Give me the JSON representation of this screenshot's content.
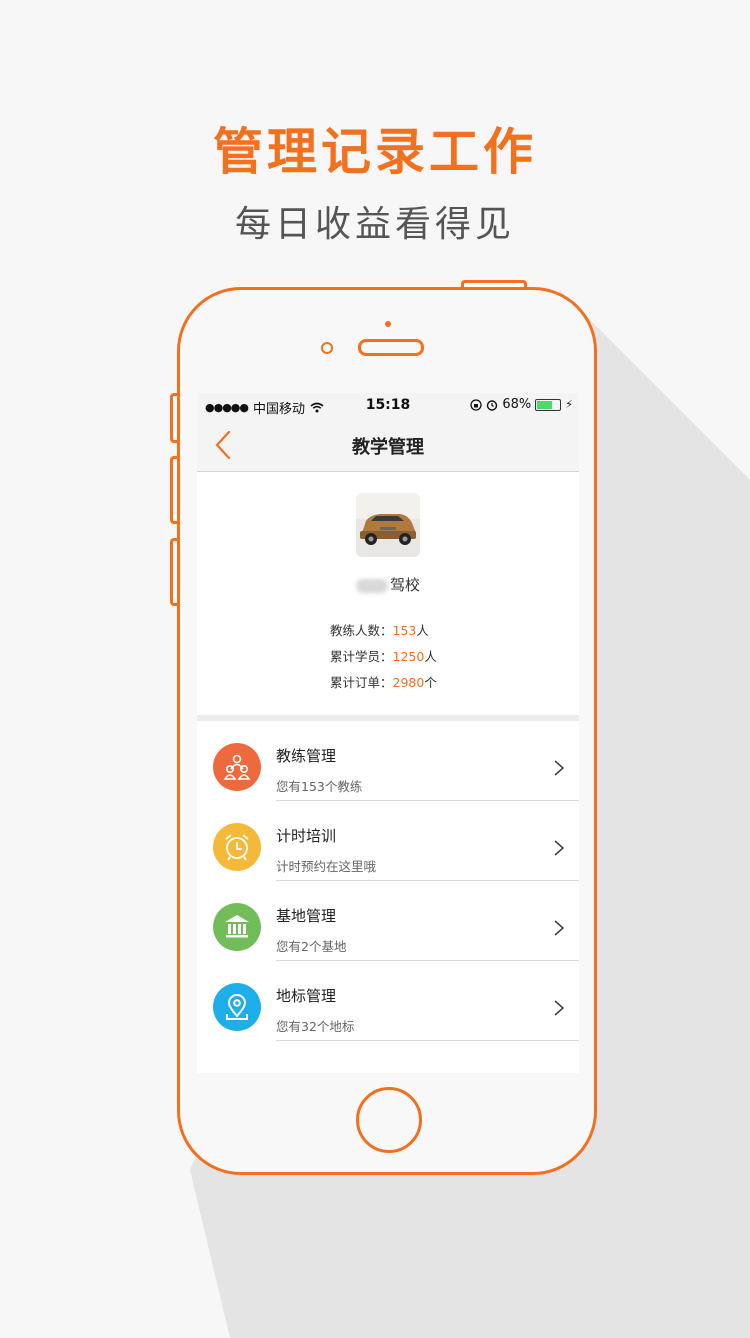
{
  "promo": {
    "headline": "管理记录工作",
    "subline": "每日收益看得见",
    "accent_color": "#f2701e"
  },
  "status_bar": {
    "carrier": "中国移动",
    "time": "15:18",
    "battery": "68%",
    "battery_level": 0.68
  },
  "nav": {
    "title": "教学管理",
    "back_icon": "chevron-left-icon"
  },
  "profile": {
    "school_name": "驾校",
    "stats": [
      {
        "label": "教练人数：",
        "value": "153",
        "unit": "人"
      },
      {
        "label": "累计学员：",
        "value": "1250",
        "unit": "人"
      },
      {
        "label": "累计订单：",
        "value": "2980",
        "unit": "个"
      }
    ]
  },
  "menu": [
    {
      "title": "教练管理",
      "subtitle": "您有153个教练",
      "icon": "people-icon",
      "color": "#ee6a3e"
    },
    {
      "title": "计时培训",
      "subtitle": "计时预约在这里哦",
      "icon": "alarm-clock-icon",
      "color": "#f5b93a"
    },
    {
      "title": "基地管理",
      "subtitle": "您有2个基地",
      "icon": "building-icon",
      "color": "#72bd5a"
    },
    {
      "title": "地标管理",
      "subtitle": "您有32个地标",
      "icon": "location-pin-icon",
      "color": "#1eaee9"
    }
  ]
}
